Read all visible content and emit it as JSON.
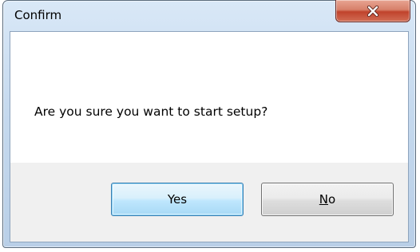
{
  "window": {
    "title": "Confirm"
  },
  "title_bar": {
    "close_icon": "close-x-icon"
  },
  "dialog": {
    "message": "Are you sure you want to start setup?"
  },
  "buttons": {
    "yes_label": "Yes",
    "no_label_mnemonic": "N",
    "no_label_rest": "o"
  },
  "colors": {
    "close_button": "#c7513b",
    "default_button_border": "#3c7fb1",
    "frame": "#c5d9ee"
  }
}
